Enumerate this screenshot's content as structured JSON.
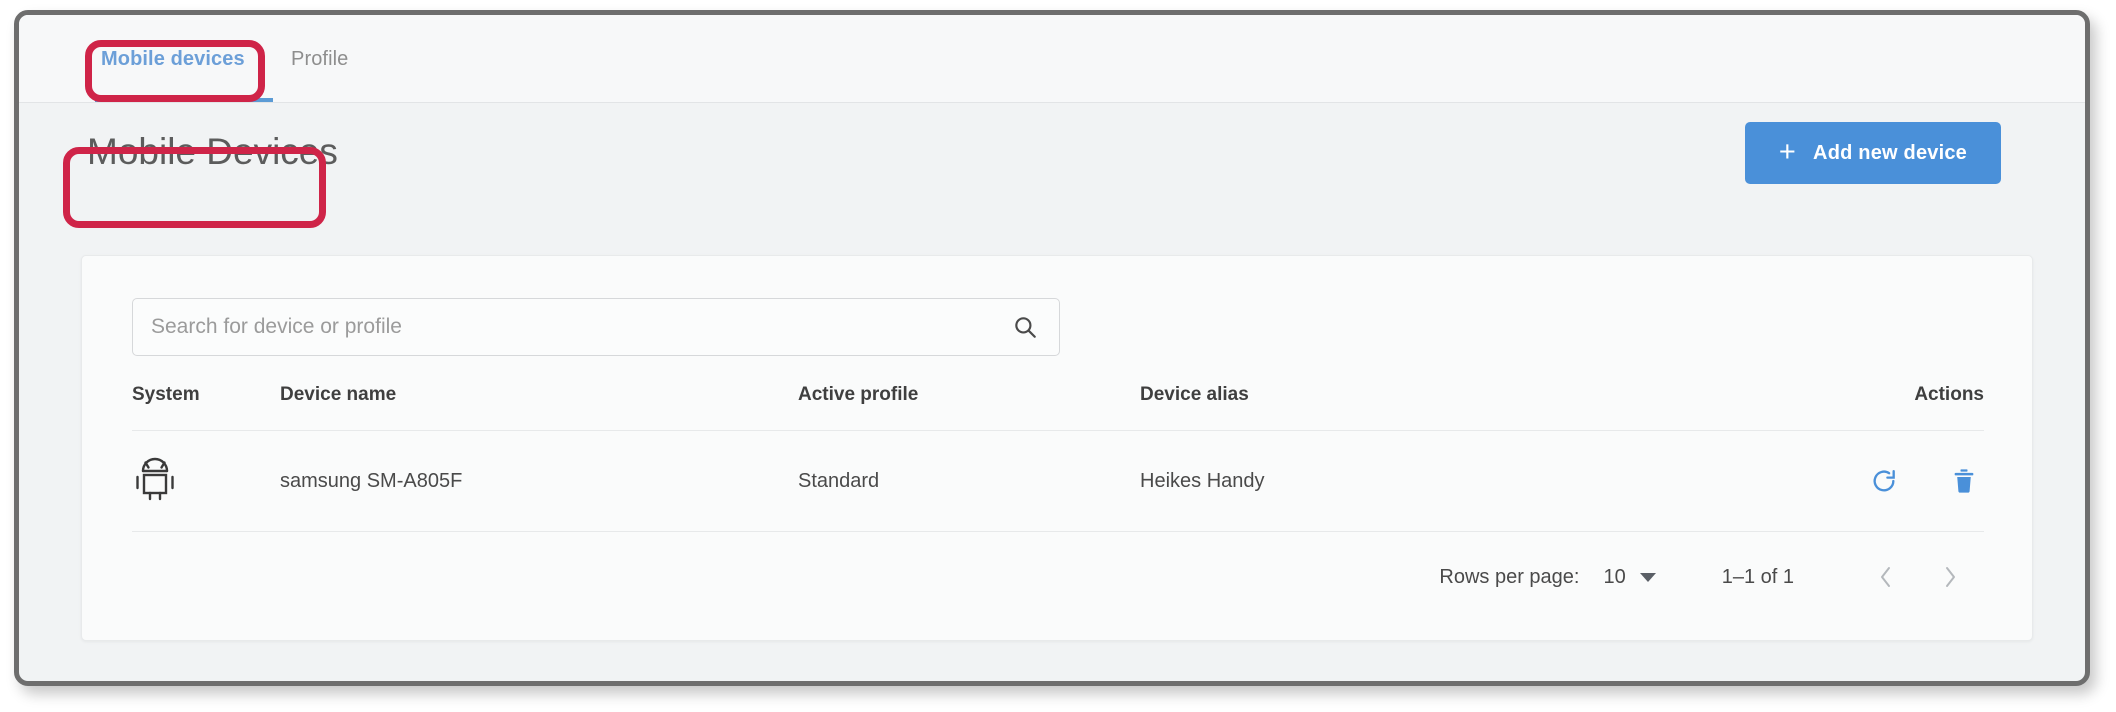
{
  "tabs": [
    {
      "label": "Mobile devices",
      "active": true
    },
    {
      "label": "Profile",
      "active": false
    }
  ],
  "header": {
    "title": "Mobile Devices",
    "add_button_label": "Add new device",
    "add_button_icon": "plus-icon",
    "add_button_color": "#4a90d9"
  },
  "search": {
    "placeholder": "Search for device or profile",
    "value": "",
    "icon": "search-icon"
  },
  "table": {
    "columns": [
      "System",
      "Device name",
      "Active profile",
      "Device alias",
      "Actions"
    ],
    "rows": [
      {
        "system_icon": "android-icon",
        "device_name": "samsung SM-A805F",
        "active_profile": "Standard",
        "device_alias": "Heikes Handy",
        "actions": [
          "refresh-icon",
          "delete-icon"
        ]
      }
    ]
  },
  "pagination": {
    "rows_per_page_label": "Rows per page:",
    "rows_per_page_value": "10",
    "range": "1–1 of 1",
    "prev_label": "‹",
    "next_label": "›"
  },
  "annotations": {
    "color": "#cf2448",
    "highlighted": [
      "Mobile devices tab",
      "Mobile Devices title"
    ]
  }
}
